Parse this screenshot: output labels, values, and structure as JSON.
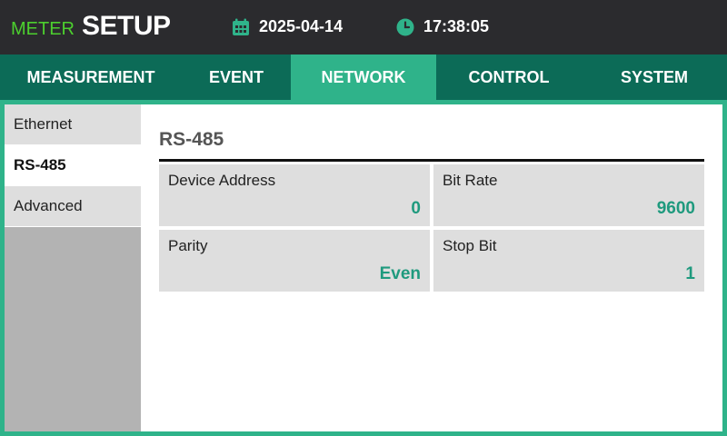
{
  "header": {
    "brand_small": "METER",
    "brand_large": "SETUP",
    "date": "2025-04-14",
    "time": "17:38:05",
    "date_icon": "calendar-icon",
    "time_icon": "clock-icon"
  },
  "tabs": [
    {
      "label": "MEASUREMENT",
      "active": false
    },
    {
      "label": "EVENT",
      "active": false
    },
    {
      "label": "NETWORK",
      "active": true
    },
    {
      "label": "CONTROL",
      "active": false
    },
    {
      "label": "SYSTEM",
      "active": false
    }
  ],
  "sidebar": {
    "items": [
      {
        "label": "Ethernet",
        "active": false
      },
      {
        "label": "RS-485",
        "active": true
      },
      {
        "label": "Advanced",
        "active": false
      }
    ]
  },
  "panel": {
    "title": "RS-485",
    "settings": [
      {
        "label": "Device Address",
        "value": "0"
      },
      {
        "label": "Bit Rate",
        "value": "9600"
      },
      {
        "label": "Parity",
        "value": "Even"
      },
      {
        "label": "Stop Bit",
        "value": "1"
      }
    ]
  },
  "colors": {
    "accent": "#2fb38a",
    "tab_bar": "#0c6b57",
    "header_bg": "#2b2b2e",
    "brand_green": "#4ccf2e",
    "value_text": "#1f9a7e"
  }
}
